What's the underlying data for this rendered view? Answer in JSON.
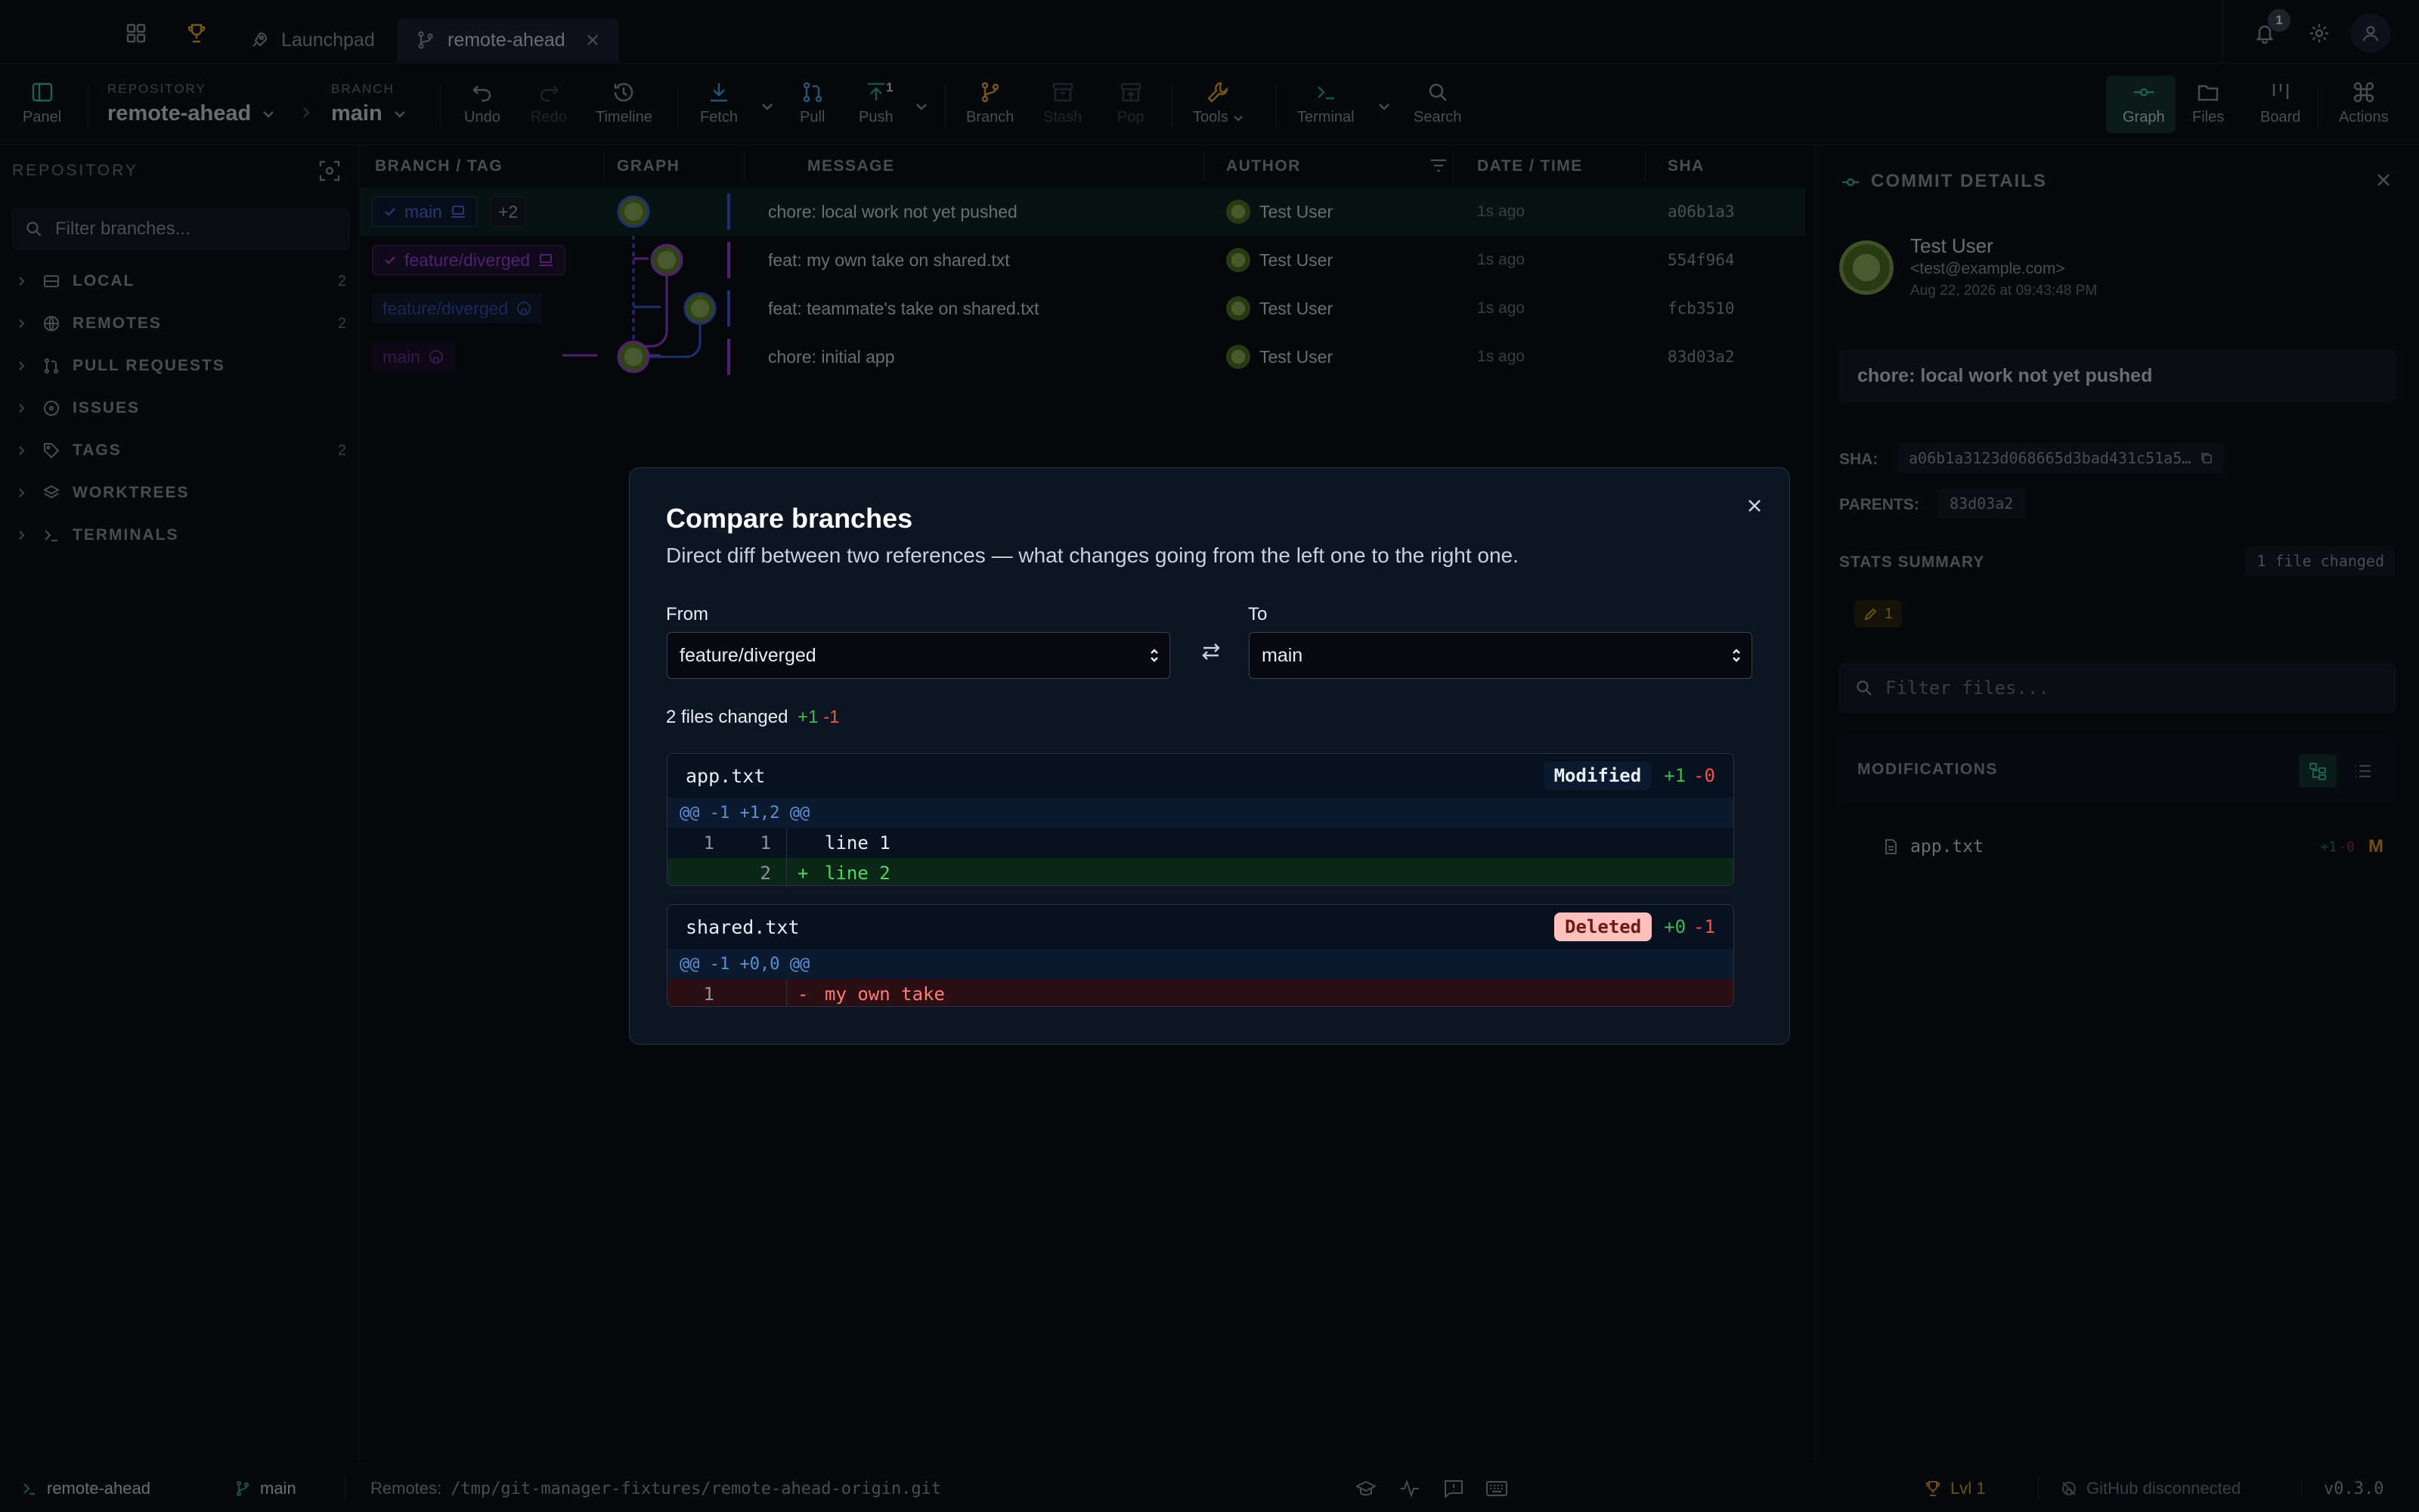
{
  "titlebar": {
    "tabs": [
      {
        "label": "Launchpad"
      },
      {
        "label": "remote-ahead"
      }
    ],
    "notification_count": "1"
  },
  "toolbar": {
    "panel": "Panel",
    "repository_label": "REPOSITORY",
    "repository_value": "remote-ahead",
    "branch_label": "BRANCH",
    "branch_value": "main",
    "undo": "Undo",
    "redo": "Redo",
    "timeline": "Timeline",
    "fetch": "Fetch",
    "pull": "Pull",
    "push": "Push",
    "push_count": "1",
    "branch": "Branch",
    "stash": "Stash",
    "pop": "Pop",
    "tools": "Tools",
    "terminal": "Terminal",
    "search": "Search",
    "graph": "Graph",
    "files": "Files",
    "board": "Board",
    "actions": "Actions"
  },
  "sidebar": {
    "title": "REPOSITORY",
    "filter_placeholder": "Filter branches...",
    "items": [
      {
        "label": "LOCAL",
        "count": "2"
      },
      {
        "label": "REMOTES",
        "count": "2"
      },
      {
        "label": "PULL REQUESTS",
        "count": ""
      },
      {
        "label": "ISSUES",
        "count": ""
      },
      {
        "label": "TAGS",
        "count": "2"
      },
      {
        "label": "WORKTREES",
        "count": ""
      },
      {
        "label": "TERMINALS",
        "count": ""
      }
    ]
  },
  "graph": {
    "columns": [
      "BRANCH / TAG",
      "GRAPH",
      "MESSAGE",
      "AUTHOR",
      "DATE / TIME",
      "SHA"
    ],
    "refs": {
      "main_local": "main",
      "more": "+2",
      "feature_local": "feature/diverged",
      "feature_remote": "feature/diverged",
      "main_remote": "main"
    },
    "commits": [
      {
        "message": "chore: local work not yet pushed",
        "author": "Test User",
        "date": "1s ago",
        "sha": "a06b1a3"
      },
      {
        "message": "feat: my own take on shared.txt",
        "author": "Test User",
        "date": "1s ago",
        "sha": "554f964"
      },
      {
        "message": "feat: teammate's take on shared.txt",
        "author": "Test User",
        "date": "1s ago",
        "sha": "fcb3510"
      },
      {
        "message": "chore: initial app",
        "author": "Test User",
        "date": "1s ago",
        "sha": "83d03a2"
      }
    ]
  },
  "details": {
    "title": "COMMIT DETAILS",
    "author_name": "Test User",
    "author_email": "<test@example.com>",
    "date": "Aug 22, 2026 at 09:43:48 PM",
    "message": "chore: local work not yet pushed",
    "sha_label": "SHA:",
    "sha_value": "a06b1a3123d068665d3bad431c51a5…",
    "parents_label": "PARENTS:",
    "parents_value": "83d03a2",
    "stats_label": "STATS SUMMARY",
    "stats_value": "1 file changed",
    "modified_count": "1",
    "filter_placeholder": "Filter files...",
    "modifications_label": "MODIFICATIONS",
    "file_name": "app.txt",
    "file_add": "+1",
    "file_del": "-0",
    "file_status": "M"
  },
  "modal": {
    "title": "Compare branches",
    "subtitle": "Direct diff between two references — what changes going from the left one to the right one.",
    "from_label": "From",
    "from_value": "feature/diverged",
    "to_label": "To",
    "to_value": "main",
    "summary": "2 files changed",
    "summary_add": "+1",
    "summary_del": "-1",
    "files": [
      {
        "name": "app.txt",
        "status": "Modified",
        "add": "+1",
        "del": "-0",
        "hunk": "@@ -1 +1,2 @@",
        "lines": [
          {
            "old": "1",
            "new": "1",
            "sign": "",
            "text": "line 1"
          },
          {
            "old": "",
            "new": "2",
            "sign": "+",
            "text": "line 2"
          }
        ]
      },
      {
        "name": "shared.txt",
        "status": "Deleted",
        "add": "+0",
        "del": "-1",
        "hunk": "@@ -1 +0,0 @@",
        "lines": [
          {
            "old": "1",
            "new": "",
            "sign": "-",
            "text": "my own take"
          }
        ]
      }
    ]
  },
  "statusbar": {
    "repo": "remote-ahead",
    "branch": "main",
    "remotes_label": "Remotes:",
    "remotes_value": "/tmp/git-manager-fixtures/remote-ahead-origin.git",
    "level": "Lvl 1",
    "github": "GitHub disconnected",
    "version": "v0.3.0"
  },
  "colors": {
    "accent": "#2ea37a",
    "add": "#3fb950",
    "del": "#f85149",
    "main_ref": "#3b5bdb",
    "feature_ref": "#9b3fd6"
  }
}
